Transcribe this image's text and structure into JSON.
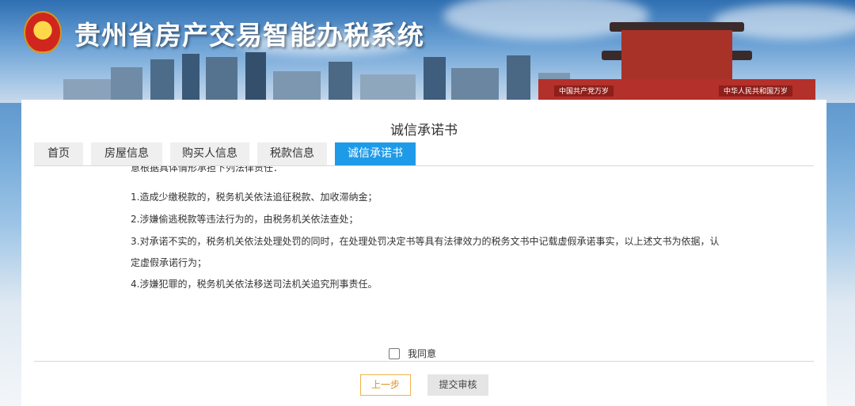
{
  "header": {
    "site_title": "贵州省房产交易智能办税系统",
    "gate_sign_left": "中国共产党万岁",
    "gate_sign_right": "中华人民共和国万岁"
  },
  "page": {
    "title": "诚信承诺书"
  },
  "tabs": [
    {
      "label": "首页",
      "active": false
    },
    {
      "label": "房屋信息",
      "active": false
    },
    {
      "label": "购买人信息",
      "active": false
    },
    {
      "label": "税款信息",
      "active": false
    },
    {
      "label": "诚信承诺书",
      "active": true
    }
  ],
  "content": {
    "lines": [
      "意根据具体情形承担下列法律责任：",
      "1.造成少缴税款的，税务机关依法追征税款、加收滞纳金；",
      "2.涉嫌偷逃税款等违法行为的，由税务机关依法查处；",
      "3.对承诺不实的，税务机关依法处理处罚的同时，在处理处罚决定书等具有法律效力的税务文书中记载虚假承诺事实，以上述文书为依据，认",
      "定虚假承诺行为；",
      "4.涉嫌犯罪的，税务机关依法移送司法机关追究刑事责任。"
    ]
  },
  "agree": {
    "label": "我同意",
    "checked": false
  },
  "buttons": {
    "prev": "上一步",
    "submit": "提交审核"
  },
  "colors": {
    "accent": "#1e9be8",
    "prev_border": "#f0b24a"
  }
}
